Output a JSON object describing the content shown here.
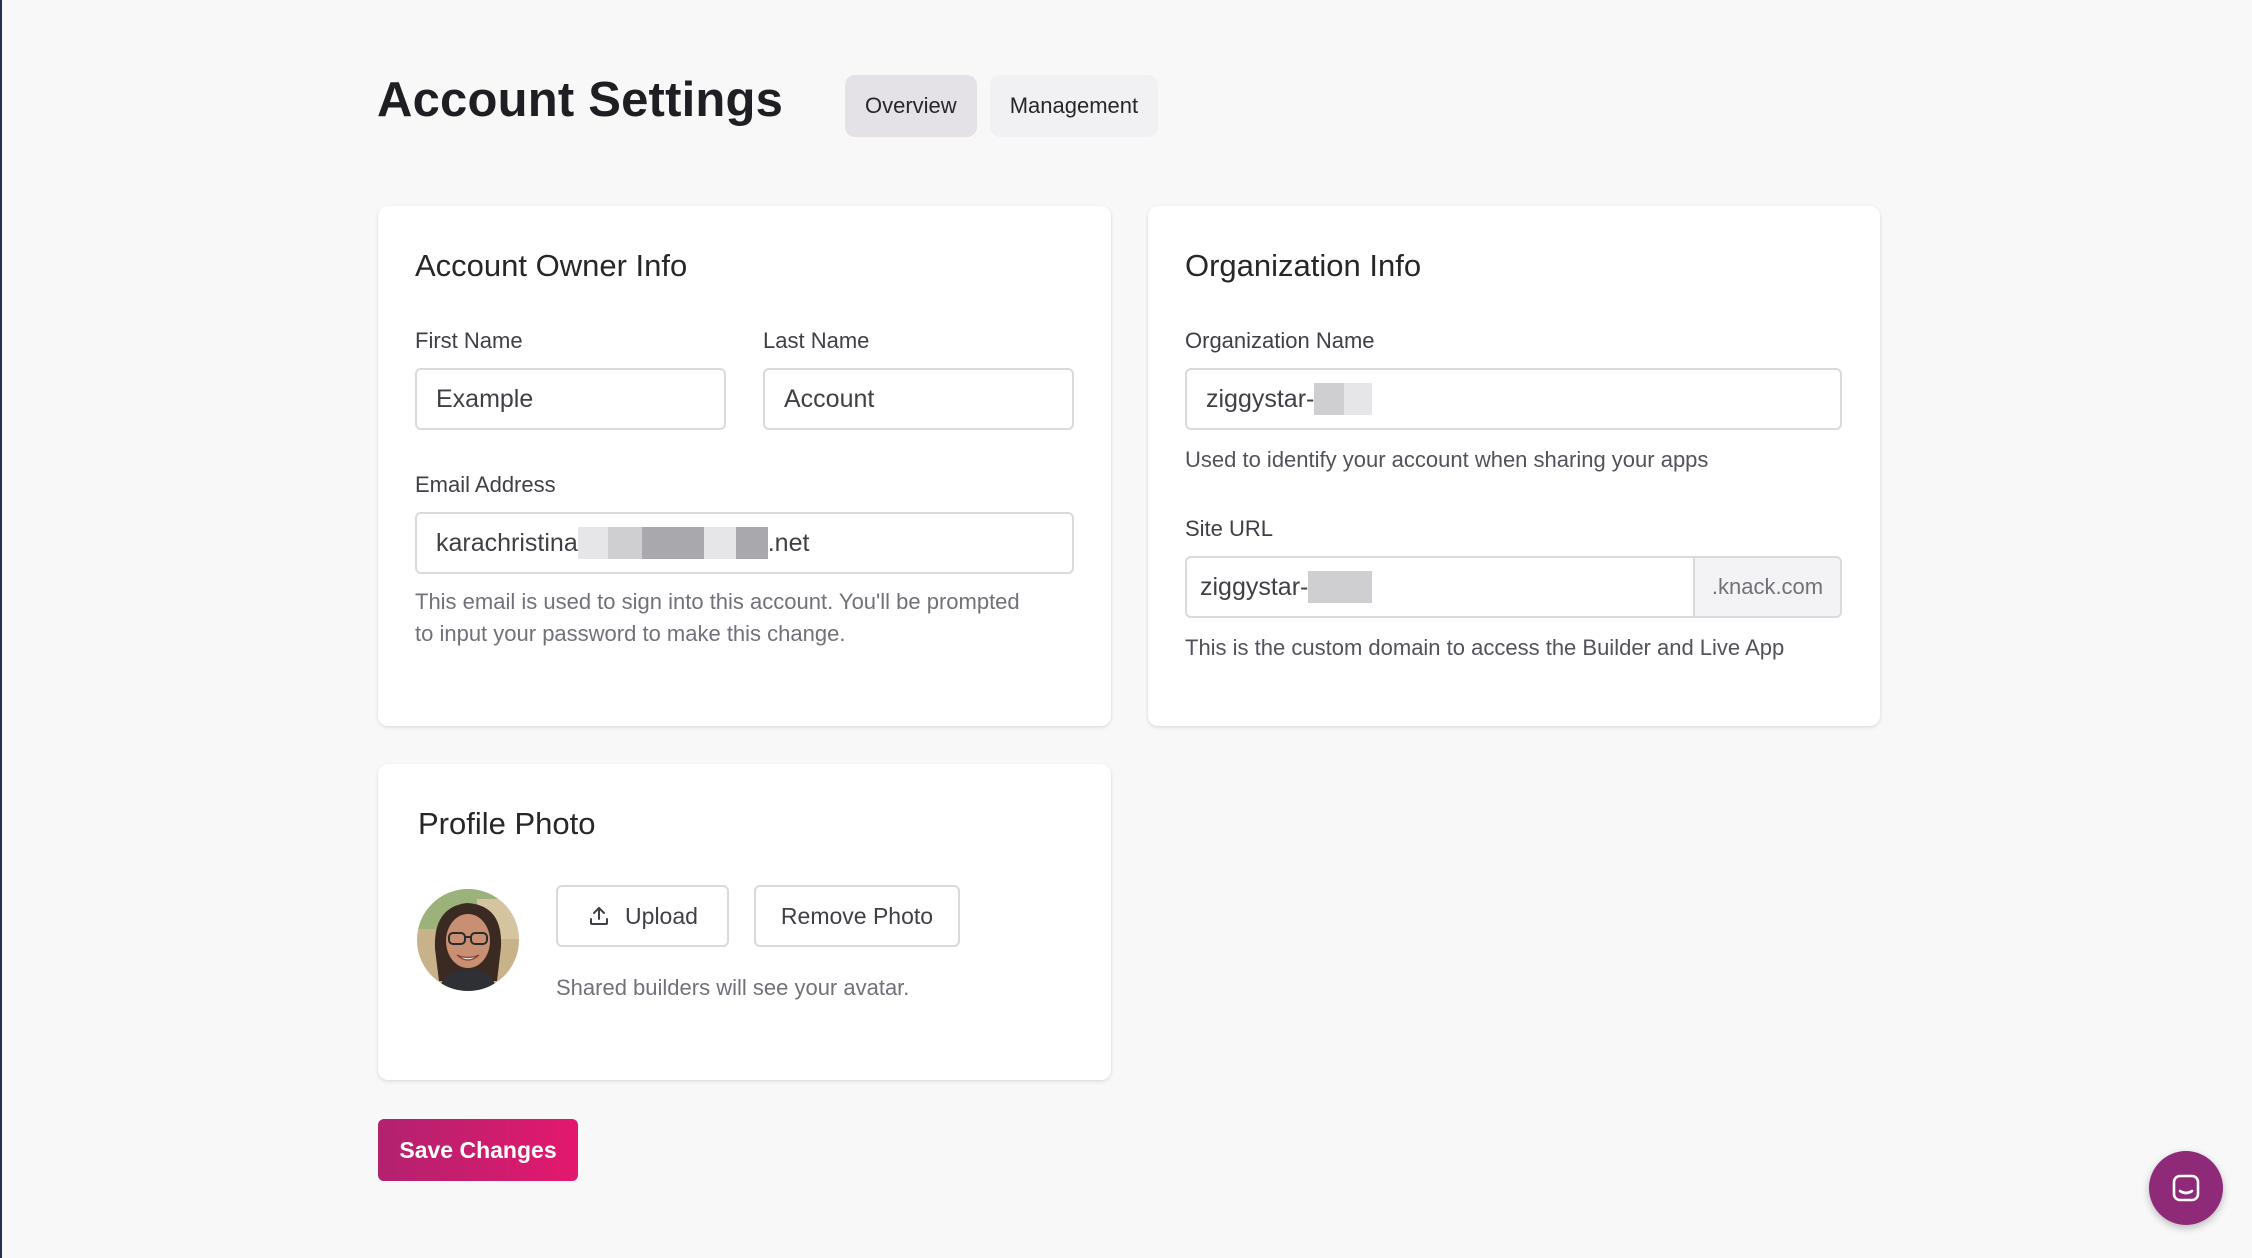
{
  "page": {
    "title": "Account Settings"
  },
  "tabs": [
    {
      "label": "Overview",
      "active": true
    },
    {
      "label": "Management",
      "active": false
    }
  ],
  "owner_card": {
    "title": "Account Owner Info",
    "first_name_label": "First Name",
    "first_name_value": "Example",
    "last_name_label": "Last Name",
    "last_name_value": "Account",
    "email_label": "Email Address",
    "email_prefix": "karachristina",
    "email_suffix": ".net",
    "email_hint_line1": "This email is used to sign into this account. You'll be prompted",
    "email_hint_line2": "to input your password to make this change."
  },
  "org_card": {
    "title": "Organization Info",
    "org_name_label": "Organization Name",
    "org_name_prefix": "ziggystar-",
    "org_name_hint": "Used to identify your account when sharing your apps",
    "site_url_label": "Site URL",
    "site_url_prefix": "ziggystar-",
    "site_url_suffix": ".knack.com",
    "site_url_hint": "This is the custom domain to access the Builder and Live App"
  },
  "photo_card": {
    "title": "Profile Photo",
    "upload_label": "Upload",
    "remove_label": "Remove Photo",
    "hint": "Shared builders will see your avatar."
  },
  "actions": {
    "save_label": "Save Changes"
  },
  "icons": {
    "upload": "upload-icon",
    "chat": "chat-icon"
  },
  "colors": {
    "accent_start": "#b2226f",
    "accent_end": "#e3186e",
    "chat_button": "#8e2a78"
  }
}
